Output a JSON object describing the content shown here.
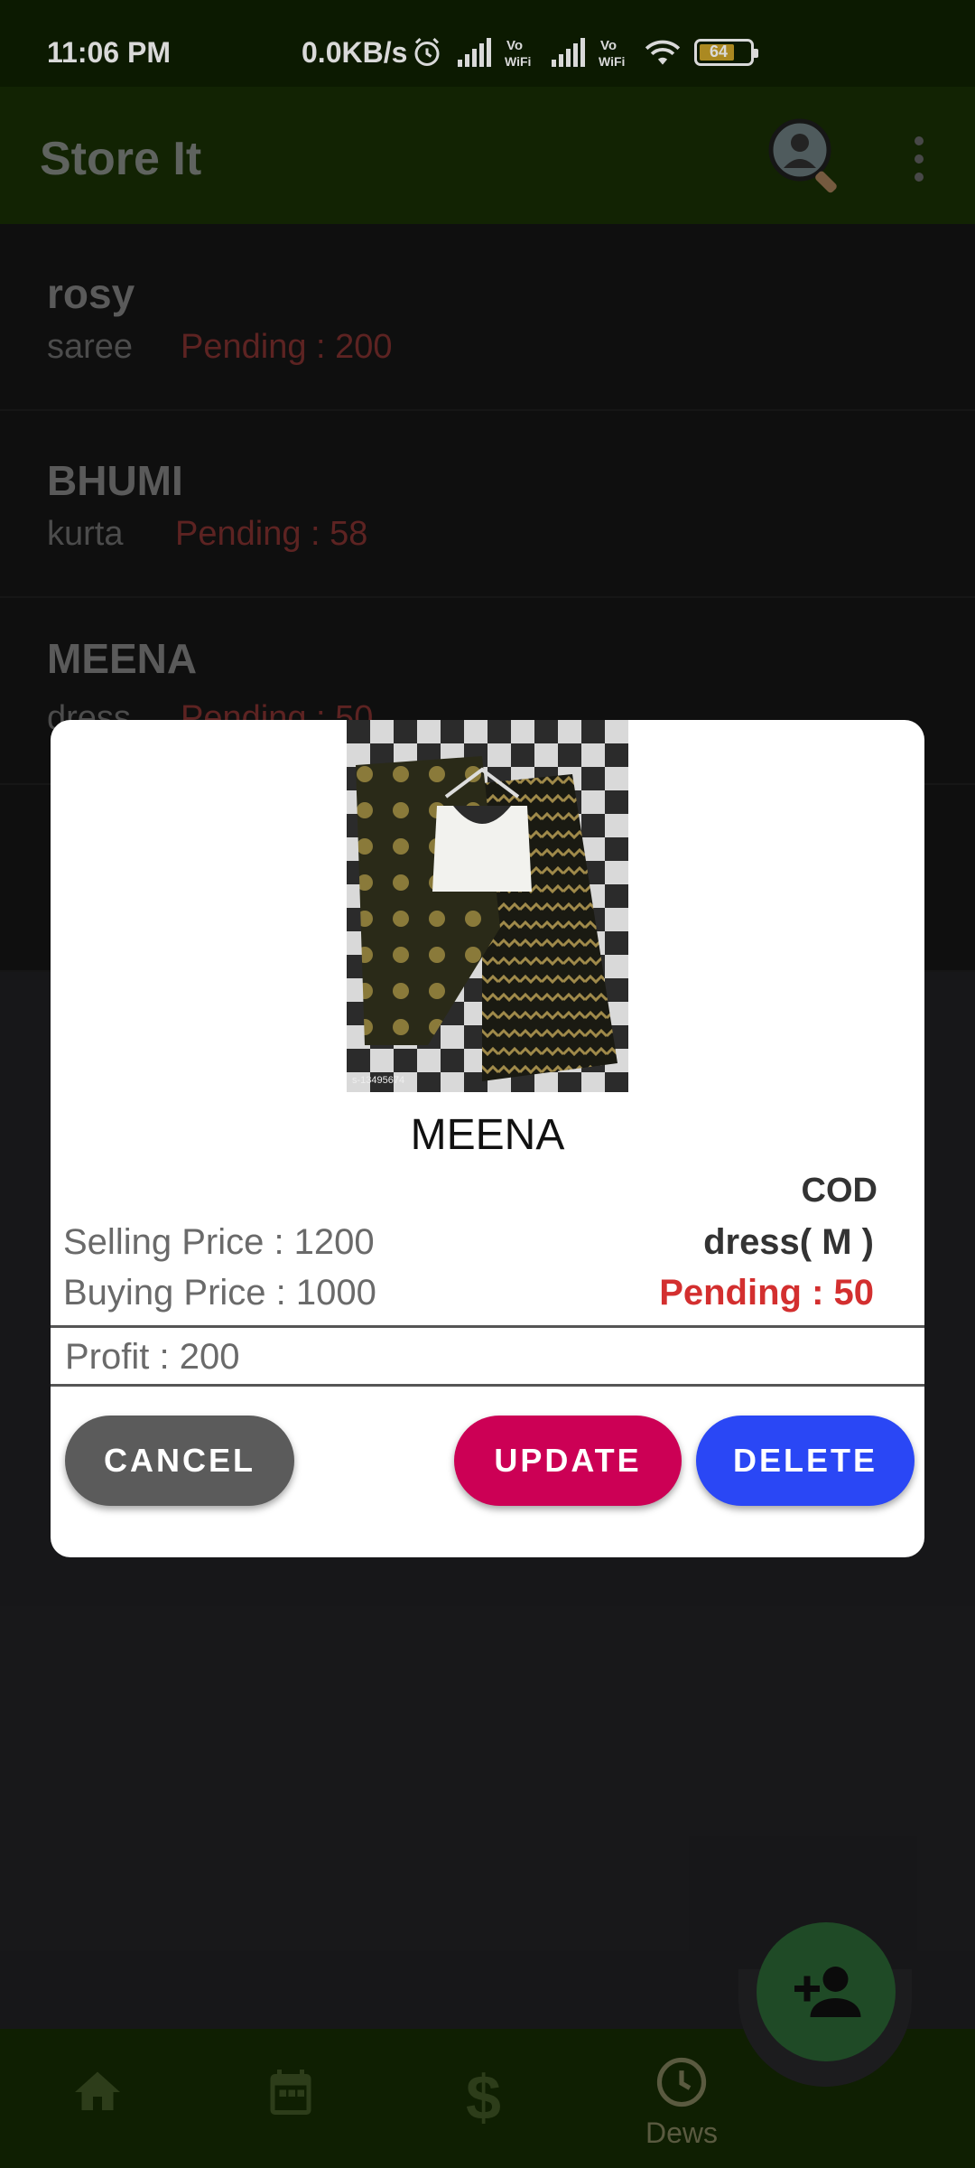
{
  "status_bar": {
    "time": "11:06 PM",
    "network_speed": "0.0KB/s",
    "battery": "64",
    "icons": [
      "alarm-icon",
      "signal-icon",
      "vowifi-icon",
      "signal-icon",
      "vowifi-icon",
      "wifi-icon",
      "battery-icon"
    ]
  },
  "app_bar": {
    "title": "Store It",
    "search_icon": "search-person-icon",
    "menu_icon": "more-vert-icon"
  },
  "list": {
    "items": [
      {
        "name": "rosy",
        "type": "saree",
        "pending": "Pending : 200"
      },
      {
        "name": "BHUMI",
        "type": "kurta",
        "pending": "Pending : 58"
      },
      {
        "name": "MEENA",
        "type": "dress",
        "pending": "Pending : 50"
      }
    ]
  },
  "dialog": {
    "image_caption": "s-13495674",
    "name": "MEENA",
    "payment": "COD",
    "selling_price": "Selling Price :  1200",
    "buying_price": "Buying Price :  1000",
    "item": "dress( M )",
    "pending": "Pending : 50",
    "profit": "Profit : 200",
    "buttons": {
      "cancel": "CANCEL",
      "update": "UPDATE",
      "delete": "DELETE"
    }
  },
  "bottom_nav": {
    "items": [
      {
        "icon": "home-icon",
        "label": ""
      },
      {
        "icon": "calendar-icon",
        "label": ""
      },
      {
        "icon": "dollar-icon",
        "label": ""
      },
      {
        "icon": "clock-icon",
        "label": "Dews"
      }
    ]
  },
  "fab": {
    "icon": "add-person-icon"
  },
  "colors": {
    "status_bar_bg": "#0f1f02",
    "app_bar_bg": "#162a04",
    "pending_red": "#d32f2f",
    "cancel_gray": "#5b5b5b",
    "update_pink": "#cc0055",
    "delete_blue": "#2a47f5",
    "fab_green": "#1f4a26"
  }
}
